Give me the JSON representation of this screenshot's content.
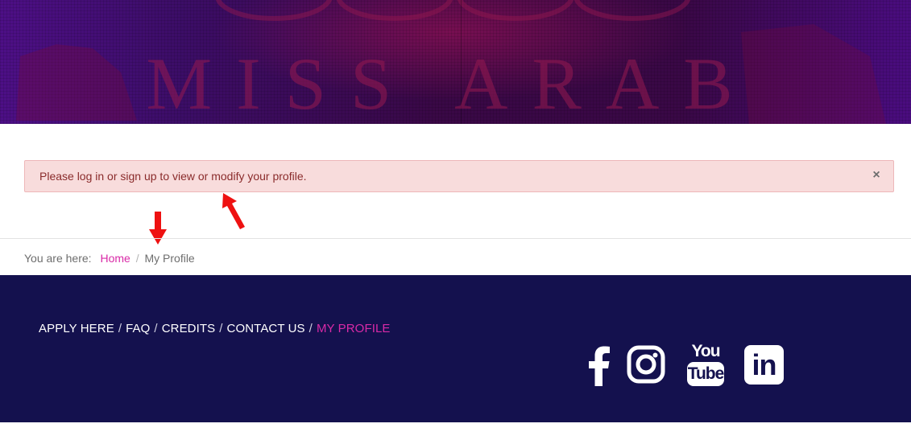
{
  "hero": {
    "banner_text": "MISS ARAB"
  },
  "alert": {
    "message": "Please log in or sign up to view or modify your profile.",
    "close_glyph": "×",
    "background_color": "#f8dcdc",
    "text_color": "#8a2b2b"
  },
  "breadcrumb": {
    "label": "You are here:",
    "items": [
      {
        "label": "Home",
        "link": true
      },
      {
        "label": "My Profile",
        "link": false
      }
    ],
    "separator": "/",
    "link_color": "#d92aa7"
  },
  "footer": {
    "background_color": "#14114e",
    "nav": [
      {
        "label": "APPLY HERE",
        "active": false
      },
      {
        "label": "FAQ",
        "active": false
      },
      {
        "label": "CREDITS",
        "active": false
      },
      {
        "label": "CONTACT US",
        "active": false
      },
      {
        "label": "MY PROFILE",
        "active": true
      }
    ],
    "separator": "/",
    "active_color": "#d92aa7",
    "social": [
      {
        "icon": "facebook-icon"
      },
      {
        "icon": "instagram-icon"
      },
      {
        "icon": "youtube-icon",
        "text_top": "You",
        "text_bottom": "Tube"
      },
      {
        "icon": "linkedin-icon",
        "text": "in"
      }
    ]
  },
  "annotations": {
    "arrow_color": "#ee1111"
  }
}
